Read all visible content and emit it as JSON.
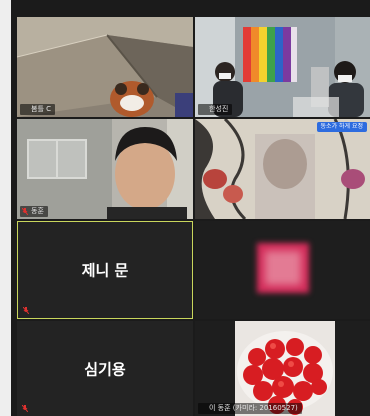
{
  "participants": [
    {
      "id": "p1",
      "name": "봄틀 C",
      "video": true,
      "muted": false
    },
    {
      "id": "p2",
      "name": "한성진",
      "video": true,
      "muted": false
    },
    {
      "id": "p3",
      "name": "동훈",
      "video": true,
      "muted": true
    },
    {
      "id": "p4",
      "name": "",
      "video": true,
      "muted": false,
      "label": "동소가 하게 요정"
    },
    {
      "id": "p5",
      "name": "제니 문",
      "video": false,
      "muted": true,
      "active_speaker": true
    },
    {
      "id": "p6",
      "name": "",
      "video": true,
      "muted": false
    },
    {
      "id": "p7",
      "name": "심기용",
      "video": false,
      "muted": true
    },
    {
      "id": "p8",
      "name": "이 동훈 (카미라: 20160527)",
      "video": true,
      "muted": false
    }
  ],
  "colors": {
    "grid_bg": "#1b1b1b",
    "tile_bg": "#232323",
    "active_speaker_border": "#c9d65c",
    "mute_icon": "#e0312f",
    "label_blue": "#2d6cdf"
  },
  "icons": {
    "muted": "microphone-muted-icon"
  }
}
